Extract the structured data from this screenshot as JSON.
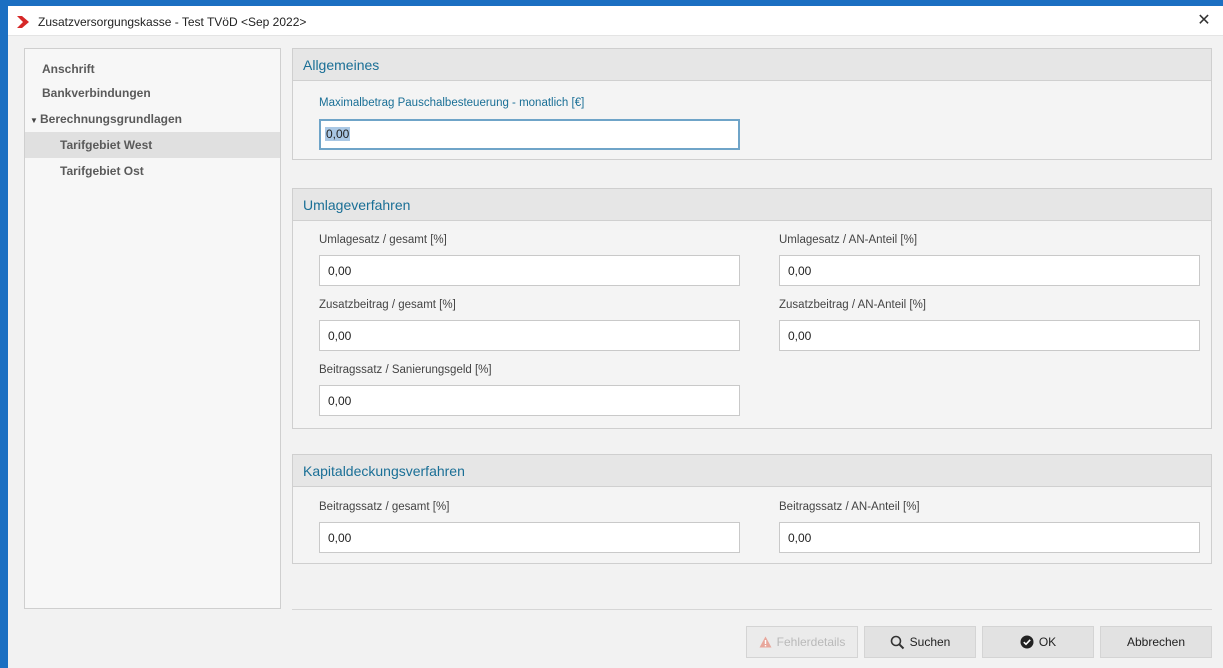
{
  "window": {
    "title": "Zusatzversorgungskasse - Test TVöD <Sep 2022>",
    "close_glyph": "✕"
  },
  "sidebar": {
    "items": [
      {
        "label": "Anschrift"
      },
      {
        "label": "Bankverbindungen"
      },
      {
        "label": "Berechnungsgrundlagen",
        "expanded_glyph": "▼"
      },
      {
        "label": "Tarifgebiet West",
        "selected": true
      },
      {
        "label": "Tarifgebiet Ost"
      }
    ]
  },
  "sections": {
    "allgemeines": {
      "title": "Allgemeines",
      "max_label": "Maximalbetrag Pauschalbesteuerung - monatlich [€]",
      "max_value": "0,00"
    },
    "umlage": {
      "title": "Umlageverfahren",
      "fields": [
        {
          "label": "Umlagesatz / gesamt [%]",
          "value": "0,00"
        },
        {
          "label": "Umlagesatz / AN-Anteil [%]",
          "value": "0,00"
        },
        {
          "label": "Zusatzbeitrag / gesamt [%]",
          "value": "0,00"
        },
        {
          "label": "Zusatzbeitrag / AN-Anteil [%]",
          "value": "0,00"
        },
        {
          "label": "Beitragssatz / Sanierungsgeld [%]",
          "value": "0,00"
        }
      ]
    },
    "kapital": {
      "title": "Kapitaldeckungsverfahren",
      "fields": [
        {
          "label": "Beitragssatz / gesamt [%]",
          "value": "0,00"
        },
        {
          "label": "Beitragssatz / AN-Anteil [%]",
          "value": "0,00"
        }
      ]
    }
  },
  "buttons": {
    "fehlerdetails": "Fehlerdetails",
    "suchen": "Suchen",
    "ok": "OK",
    "abbrechen": "Abbrechen"
  },
  "colors": {
    "accent": "#1b6fc2",
    "section_title": "#1a6f96",
    "logo_red": "#d62828",
    "warning": "#e05a47"
  },
  "icons": {
    "logo": "red-chevron-logo-icon",
    "warning": "warning-icon",
    "search": "search-icon",
    "ok": "check-circle-icon"
  }
}
